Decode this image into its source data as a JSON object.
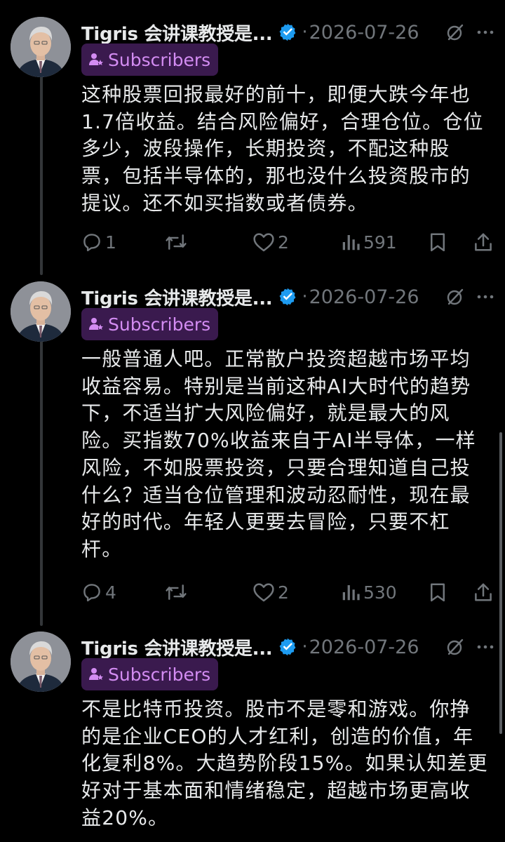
{
  "tweets": [
    {
      "author": "Tigris 会讲课教授是...",
      "date": "2026-07-26",
      "badge": "Subscribers",
      "text": "这种股票回报最好的前十，即便大跌今年也1.7倍收益。结合风险偏好，合理仓位。仓位多少，波段操作，长期投资，不配这种股票，包括半导体的，那也没什么投资股市的提议。还不如买指数或者债券。",
      "replies": "1",
      "retweets": "",
      "likes": "2",
      "views": "591"
    },
    {
      "author": "Tigris 会讲课教授是...",
      "date": "2026-07-26",
      "badge": "Subscribers",
      "text": "一般普通人吧。正常散户投资超越市场平均收益容易。特别是当前这种AI大时代的趋势下，不适当扩大风险偏好，就是最大的风险。买指数70%收益来自于AI半导体，一样风险，不如股票投资，只要合理知道自己投什么？适当仓位管理和波动忍耐性，现在最好的时代。年轻人更要去冒险，只要不杠杆。",
      "replies": "4",
      "retweets": "",
      "likes": "2",
      "views": "530"
    },
    {
      "author": "Tigris 会讲课教授是...",
      "date": "2026-07-26",
      "badge": "Subscribers",
      "text": "不是比特币投资。股市不是零和游戏。你挣的是企业CEO的人才红利，创造的价值，年化复利8%。大趋势阶段15%。如果认知差更好对于基本面和情绪稳定，超越市场更高收益20%。"
    }
  ],
  "separator": "·",
  "colors": {
    "background": "#000000",
    "text": "#e7e9ea",
    "muted": "#71767b",
    "badge_bg": "#3a1a4e",
    "badge_text": "#d38cf2",
    "verified": "#1d9bf0"
  },
  "icons": {
    "header": [
      "verified-badge-icon",
      "grok-icon",
      "more-icon"
    ],
    "badge": "subscriber-person-star-icon",
    "actions": [
      "reply-icon",
      "retweet-icon",
      "like-icon",
      "views-icon",
      "bookmark-icon",
      "share-icon"
    ]
  }
}
